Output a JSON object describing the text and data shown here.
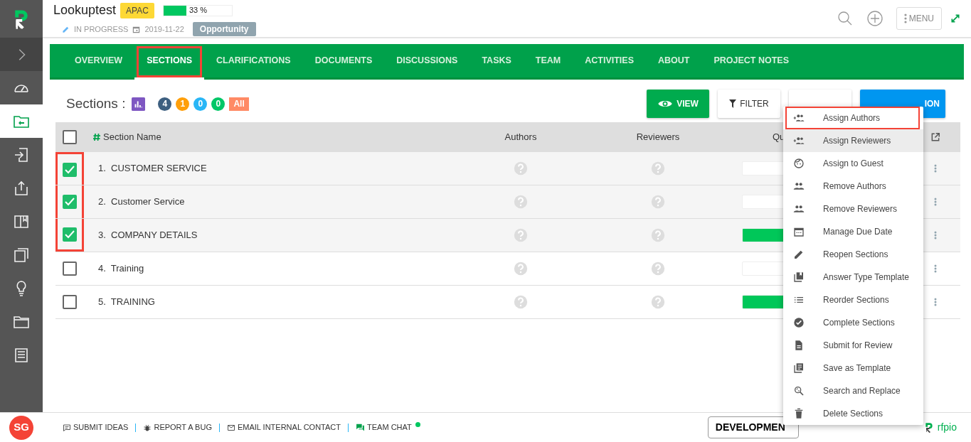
{
  "sidebar": {
    "items": [
      {
        "selected": false
      },
      {
        "selected": true
      },
      {
        "selected": false
      },
      {
        "selected": false
      },
      {
        "selected": false
      },
      {
        "selected": false
      },
      {
        "selected": false
      },
      {
        "selected": false
      },
      {
        "selected": false
      }
    ],
    "avatar": "SG"
  },
  "header": {
    "title": "Lookuptest",
    "region": "APAC",
    "progress": {
      "level": 0.33,
      "reading": "33 %"
    },
    "status": "IN PROGRESS",
    "date": "2019-11-22",
    "type": "Opportunity",
    "menu_label": "MENU"
  },
  "tabs": [
    {
      "label": "OVERVIEW",
      "selected": false,
      "highlighted": false
    },
    {
      "label": "SECTIONS",
      "selected": true,
      "highlighted": true
    },
    {
      "label": "CLARIFICATIONS",
      "selected": false,
      "highlighted": false
    },
    {
      "label": "DOCUMENTS",
      "selected": false,
      "highlighted": false
    },
    {
      "label": "DISCUSSIONS",
      "selected": false,
      "highlighted": false
    },
    {
      "label": "TASKS",
      "selected": false,
      "highlighted": false
    },
    {
      "label": "TEAM",
      "selected": false,
      "highlighted": false
    },
    {
      "label": "ACTIVITIES",
      "selected": false,
      "highlighted": false
    },
    {
      "label": "ABOUT",
      "selected": false,
      "highlighted": false
    },
    {
      "label": "PROJECT NOTES",
      "selected": false,
      "highlighted": false
    }
  ],
  "sections": {
    "title": "Sections :",
    "counts": [
      {
        "value": "4",
        "kind": "circle",
        "color": "#3d5f80"
      },
      {
        "value": "1",
        "kind": "circle",
        "color": "#ff9f0a"
      },
      {
        "value": "0",
        "kind": "circle",
        "color": "#29b6f6"
      },
      {
        "value": "0",
        "kind": "circle",
        "color": "#00c767"
      },
      {
        "value": "All",
        "kind": "square",
        "color": "#ff8a65"
      }
    ]
  },
  "toolbar": {
    "buttons": [
      {
        "label": "VIEW",
        "kind": "view"
      },
      {
        "label": "FILTER",
        "kind": "filter"
      },
      {
        "kind": "hidden"
      },
      {
        "label": "ION",
        "kind": "add"
      }
    ]
  },
  "table": {
    "columns": [
      "Section Name",
      "Authors",
      "Reviewers",
      "Qu"
    ],
    "select_all": {
      "checked": false
    },
    "rows": [
      {
        "number": "1.",
        "name": "CUSTOMER SERVICE",
        "checked": true,
        "highlighted": true,
        "level": 0
      },
      {
        "number": "2.",
        "name": "Customer Service",
        "checked": true,
        "highlighted": true,
        "level": 0
      },
      {
        "number": "3.",
        "name": "COMPANY DETAILS",
        "checked": true,
        "highlighted": true,
        "level": 1
      },
      {
        "number": "4.",
        "name": "Training",
        "checked": false,
        "highlighted": false,
        "level": 0
      },
      {
        "number": "5.",
        "name": "TRAINING",
        "checked": false,
        "highlighted": false,
        "level": 1
      }
    ]
  },
  "menu": {
    "items": [
      {
        "label": "Assign Authors",
        "hovered": false,
        "highlighted": true
      },
      {
        "label": "Assign Reviewers",
        "hovered": true,
        "highlighted": false
      },
      {
        "label": "Assign to Guest",
        "hovered": false,
        "highlighted": false
      },
      {
        "label": "Remove Authors",
        "hovered": false,
        "highlighted": false
      },
      {
        "label": "Remove Reviewers",
        "hovered": false,
        "highlighted": false
      },
      {
        "label": "Manage Due Date",
        "hovered": false,
        "highlighted": false
      },
      {
        "label": "Reopen Sections",
        "hovered": false,
        "highlighted": false
      },
      {
        "label": "Answer Type Template",
        "hovered": false,
        "highlighted": false
      },
      {
        "label": "Reorder Sections",
        "hovered": false,
        "highlighted": false
      },
      {
        "label": "Complete Sections",
        "hovered": false,
        "highlighted": false
      },
      {
        "label": "Submit for Review",
        "hovered": false,
        "highlighted": false
      },
      {
        "label": "Save as Template",
        "hovered": false,
        "highlighted": false
      },
      {
        "label": "Search and Replace",
        "hovered": false,
        "highlighted": false
      },
      {
        "label": "Delete Sections",
        "hovered": false,
        "highlighted": false
      }
    ]
  },
  "footer": {
    "links": [
      "SUBMIT IDEAS",
      "REPORT A BUG",
      "EMAIL INTERNAL CONTACT"
    ],
    "chat": {
      "label": "TEAM CHAT",
      "online": true
    },
    "environment": "DEVELOPMEN",
    "brand": "rfpio"
  }
}
